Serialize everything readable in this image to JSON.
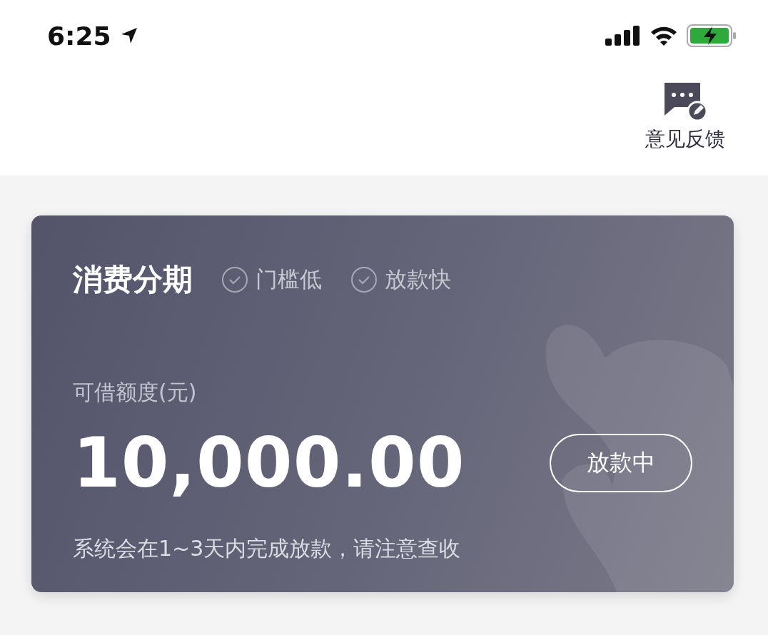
{
  "status_bar": {
    "time": "6:25"
  },
  "header": {
    "feedback": {
      "label": "意见反馈"
    }
  },
  "card": {
    "title": "消费分期",
    "tags": [
      {
        "label": "门槛低"
      },
      {
        "label": "放款快"
      }
    ],
    "amount_label": "可借额度(元)",
    "amount": "10,000.00",
    "status_button": "放款中",
    "note": "系统会在1~3天内完成放款，请注意查收"
  }
}
